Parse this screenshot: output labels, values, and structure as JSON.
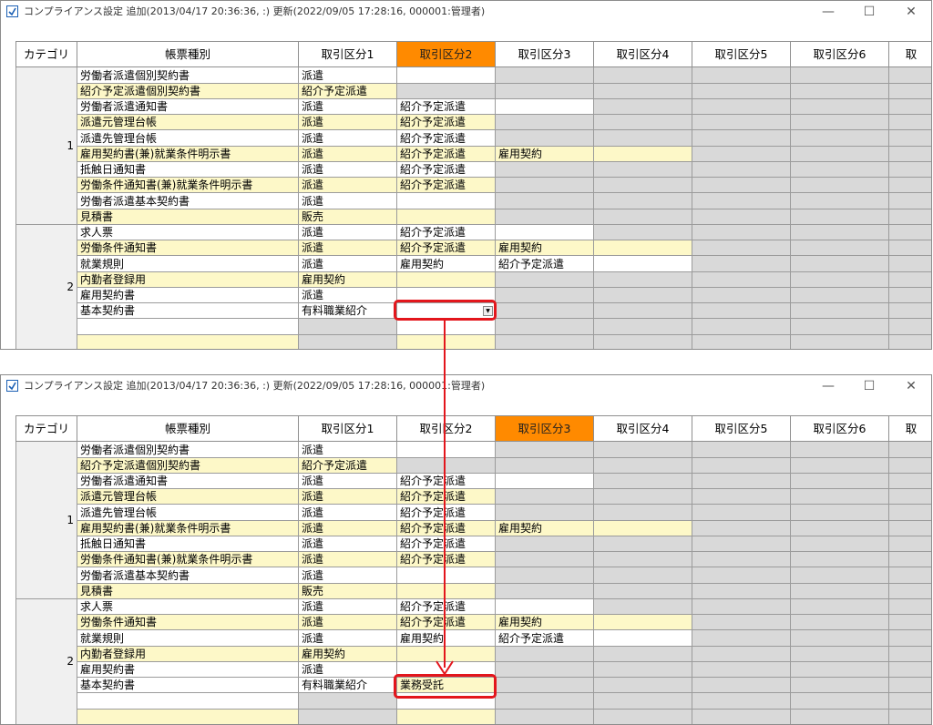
{
  "title": "コンプライアンス設定 追加(2013/04/17 20:36:36, :) 更新(2022/09/05 17:28:16, 000001:管理者)",
  "window_controls": {
    "minimize": "—",
    "maximize": "☐",
    "close": "✕"
  },
  "colors": {
    "active_header": "#ff8a00",
    "highlight": "#e3161c",
    "yellow_row": "#fdf8c8",
    "disabled": "#d9d9d9"
  },
  "headers": [
    "カテゴリ",
    "帳票種別",
    "取引区分1",
    "取引区分2",
    "取引区分3",
    "取引区分4",
    "取引区分5",
    "取引区分6",
    "取"
  ],
  "screens": [
    {
      "active_header_index": 3,
      "rows": [
        {
          "cat": "",
          "kind": "労働者派遣個別契約書",
          "c1": "派遣",
          "c2": "",
          "c3": ""
        },
        {
          "cat": "",
          "kind": "紹介予定派遣個別契約書",
          "c1": "紹介予定派遣",
          "c2": "",
          "c3": ""
        },
        {
          "cat": "",
          "kind": "労働者派遣通知書",
          "c1": "派遣",
          "c2": "紹介予定派遣",
          "c3": ""
        },
        {
          "cat": "",
          "kind": "派遣元管理台帳",
          "c1": "派遣",
          "c2": "紹介予定派遣",
          "c3": ""
        },
        {
          "cat": "",
          "kind": "派遣先管理台帳",
          "c1": "派遣",
          "c2": "紹介予定派遣",
          "c3": ""
        },
        {
          "cat": "1",
          "kind": "雇用契約書(兼)就業条件明示書",
          "c1": "派遣",
          "c2": "紹介予定派遣",
          "c3": "雇用契約"
        },
        {
          "cat": "",
          "kind": "抵触日通知書",
          "c1": "派遣",
          "c2": "紹介予定派遣",
          "c3": ""
        },
        {
          "cat": "",
          "kind": "労働条件通知書(兼)就業条件明示書",
          "c1": "派遣",
          "c2": "紹介予定派遣",
          "c3": ""
        },
        {
          "cat": "",
          "kind": "労働者派遣基本契約書",
          "c1": "派遣",
          "c2": "",
          "c3": ""
        },
        {
          "cat": "",
          "kind": "見積書",
          "c1": "販売",
          "c2": "",
          "c3": ""
        },
        {
          "cat": "",
          "kind": "求人票",
          "c1": "派遣",
          "c2": "紹介予定派遣",
          "c3": ""
        },
        {
          "cat": "",
          "kind": "労働条件通知書",
          "c1": "派遣",
          "c2": "紹介予定派遣",
          "c3": "雇用契約"
        },
        {
          "cat": "",
          "kind": "就業規則",
          "c1": "派遣",
          "c2": "雇用契約",
          "c3": "紹介予定派遣"
        },
        {
          "cat": "",
          "kind": "内勤者登録用",
          "c1": "雇用契約",
          "c2": "",
          "c3": ""
        },
        {
          "cat": "2",
          "kind": "雇用契約書",
          "c1": "派遣",
          "c2": "",
          "c3": ""
        },
        {
          "cat": "",
          "kind": "基本契約書",
          "c1": "有料職業紹介",
          "c2": "",
          "c3": ""
        },
        {
          "cat": "",
          "kind": "",
          "c1": "",
          "c2": "",
          "c3": ""
        },
        {
          "cat": "",
          "kind": "",
          "c1": "",
          "c2": "",
          "c3": ""
        }
      ]
    },
    {
      "active_header_index": 4,
      "rows": [
        {
          "cat": "",
          "kind": "労働者派遣個別契約書",
          "c1": "派遣",
          "c2": "",
          "c3": ""
        },
        {
          "cat": "",
          "kind": "紹介予定派遣個別契約書",
          "c1": "紹介予定派遣",
          "c2": "",
          "c3": ""
        },
        {
          "cat": "",
          "kind": "労働者派遣通知書",
          "c1": "派遣",
          "c2": "紹介予定派遣",
          "c3": ""
        },
        {
          "cat": "",
          "kind": "派遣元管理台帳",
          "c1": "派遣",
          "c2": "紹介予定派遣",
          "c3": ""
        },
        {
          "cat": "",
          "kind": "派遣先管理台帳",
          "c1": "派遣",
          "c2": "紹介予定派遣",
          "c3": ""
        },
        {
          "cat": "1",
          "kind": "雇用契約書(兼)就業条件明示書",
          "c1": "派遣",
          "c2": "紹介予定派遣",
          "c3": "雇用契約"
        },
        {
          "cat": "",
          "kind": "抵触日通知書",
          "c1": "派遣",
          "c2": "紹介予定派遣",
          "c3": ""
        },
        {
          "cat": "",
          "kind": "労働条件通知書(兼)就業条件明示書",
          "c1": "派遣",
          "c2": "紹介予定派遣",
          "c3": ""
        },
        {
          "cat": "",
          "kind": "労働者派遣基本契約書",
          "c1": "派遣",
          "c2": "",
          "c3": ""
        },
        {
          "cat": "",
          "kind": "見積書",
          "c1": "販売",
          "c2": "",
          "c3": ""
        },
        {
          "cat": "",
          "kind": "求人票",
          "c1": "派遣",
          "c2": "紹介予定派遣",
          "c3": ""
        },
        {
          "cat": "",
          "kind": "労働条件通知書",
          "c1": "派遣",
          "c2": "紹介予定派遣",
          "c3": "雇用契約"
        },
        {
          "cat": "",
          "kind": "就業規則",
          "c1": "派遣",
          "c2": "雇用契約",
          "c3": "紹介予定派遣"
        },
        {
          "cat": "",
          "kind": "内勤者登録用",
          "c1": "雇用契約",
          "c2": "",
          "c3": ""
        },
        {
          "cat": "2",
          "kind": "雇用契約書",
          "c1": "派遣",
          "c2": "",
          "c3": ""
        },
        {
          "cat": "",
          "kind": "基本契約書",
          "c1": "有料職業紹介",
          "c2": "業務受託",
          "c3": ""
        },
        {
          "cat": "",
          "kind": "",
          "c1": "",
          "c2": "",
          "c3": ""
        },
        {
          "cat": "",
          "kind": "",
          "c1": "",
          "c2": "",
          "c3": ""
        }
      ]
    }
  ]
}
